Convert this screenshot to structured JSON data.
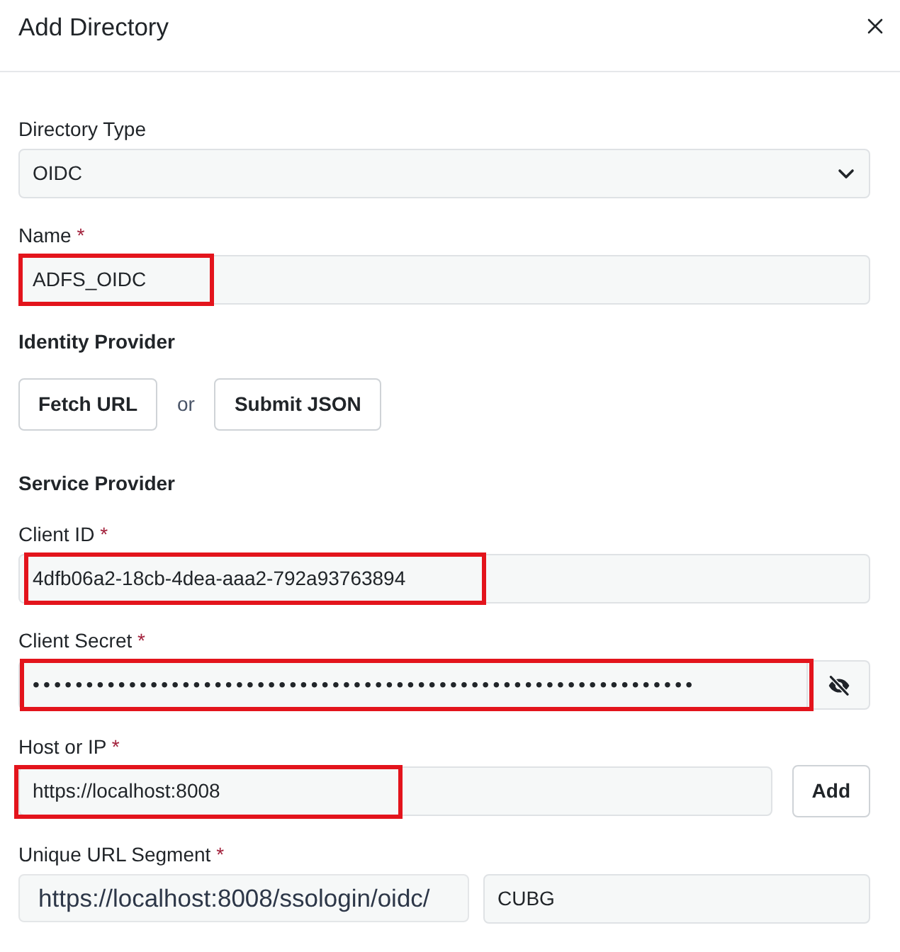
{
  "dialog": {
    "title": "Add Directory"
  },
  "form": [
    {
      "kind": "select",
      "label": "Directory Type",
      "value": "OIDC",
      "highlighted": false
    },
    {
      "kind": "text",
      "label": "Name",
      "required_mark": "*",
      "value": "ADFS_OIDC",
      "highlighted": true
    },
    {
      "kind": "heading",
      "text": "Identity Provider"
    },
    {
      "kind": "buttons",
      "items": [
        {
          "kind": "button",
          "label": "Fetch URL"
        },
        {
          "kind": "separator",
          "text": "or"
        },
        {
          "kind": "button",
          "label": "Submit JSON"
        }
      ]
    },
    {
      "kind": "heading",
      "text": "Service Provider"
    },
    {
      "kind": "text",
      "label": "Client ID",
      "required_mark": "*",
      "value": "4dfb06a2-18cb-4dea-aaa2-792a93763894",
      "highlighted": true
    },
    {
      "kind": "password",
      "label": "Client Secret",
      "required_mark": "*",
      "value": "••••••••••••••••••••••••••••••••••••••••••••••••••••••••••••••",
      "highlighted": true
    },
    {
      "kind": "text_button",
      "label": "Host or IP",
      "required_mark": "*",
      "value": "https://localhost:8008",
      "button": "Add",
      "highlighted": true
    },
    {
      "kind": "prefixed",
      "label": "Unique URL Segment",
      "required_mark": "*",
      "prefix": "https://localhost:8008/ssologin/oidc/",
      "value": "CUBG",
      "highlighted": false
    }
  ]
}
